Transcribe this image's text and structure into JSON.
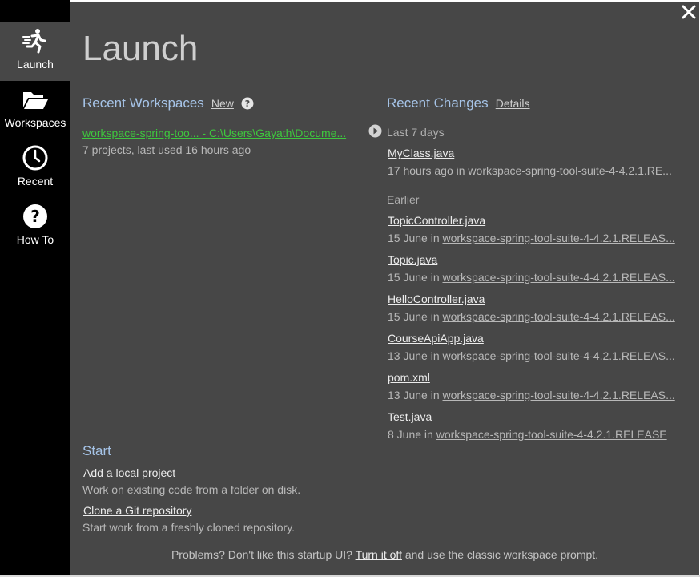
{
  "sidebar": {
    "items": [
      {
        "label": "Launch",
        "icon": "runner-icon",
        "active": true
      },
      {
        "label": "Workspaces",
        "icon": "folder-open-icon",
        "active": false
      },
      {
        "label": "Recent",
        "icon": "clock-icon",
        "active": false
      },
      {
        "label": "How To",
        "icon": "question-icon",
        "active": false
      }
    ]
  },
  "header": {
    "title": "Launch",
    "close_icon": "close-icon"
  },
  "recent_workspaces": {
    "title": "Recent Workspaces",
    "new_label": "New",
    "help_icon": "help-circle-icon",
    "items": [
      {
        "name": "workspace-spring-too... - C:\\Users\\Gayath\\Docume...",
        "meta": "7 projects, last used 16 hours ago"
      }
    ]
  },
  "recent_changes": {
    "title": "Recent Changes",
    "details_label": "Details",
    "groups": [
      {
        "label": "Last 7 days",
        "items": [
          {
            "file": "MyClass.java",
            "when": "17 hours ago in",
            "workspace": "workspace-spring-tool-suite-4-4.2.1.RE..."
          }
        ]
      },
      {
        "label": "Earlier",
        "items": [
          {
            "file": "TopicController.java",
            "when": "15 June in",
            "workspace": "workspace-spring-tool-suite-4-4.2.1.RELEAS..."
          },
          {
            "file": "Topic.java",
            "when": "15 June in",
            "workspace": "workspace-spring-tool-suite-4-4.2.1.RELEAS..."
          },
          {
            "file": "HelloController.java",
            "when": "15 June in",
            "workspace": "workspace-spring-tool-suite-4-4.2.1.RELEAS..."
          },
          {
            "file": "CourseApiApp.java",
            "when": "13 June in",
            "workspace": "workspace-spring-tool-suite-4-4.2.1.RELEAS..."
          },
          {
            "file": "pom.xml",
            "when": "13 June in",
            "workspace": "workspace-spring-tool-suite-4-4.2.1.RELEAS..."
          },
          {
            "file": "Test.java",
            "when": "8 June in",
            "workspace": "workspace-spring-tool-suite-4-4.2.1.RELEASE"
          }
        ]
      }
    ]
  },
  "start": {
    "title": "Start",
    "actions": [
      {
        "label": "Add a local project",
        "desc": "Work on existing code from a folder on disk."
      },
      {
        "label": "Clone a Git repository",
        "desc": "Start work from a freshly cloned repository."
      }
    ]
  },
  "footer": {
    "before": "Problems? Don't like this startup UI? ",
    "link": "Turn it off",
    "after": " and use the classic workspace prompt."
  },
  "colors": {
    "sidebar_bg": "#000000",
    "sidebar_active": "#474747",
    "main_bg": "#474747",
    "section_title": "#a6c4e8",
    "workspace_link": "#3ec63e"
  }
}
